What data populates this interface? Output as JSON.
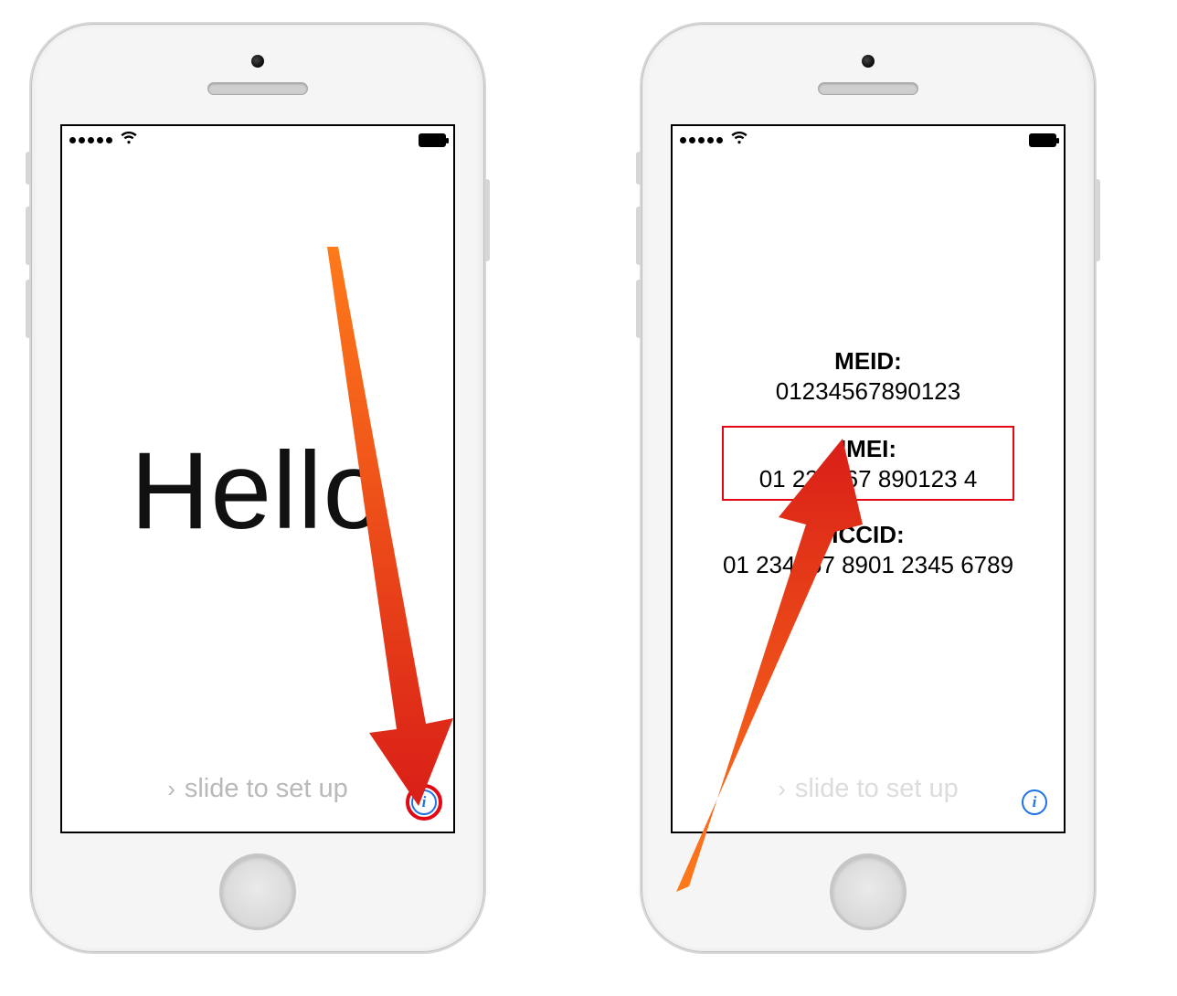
{
  "left_screen": {
    "greeting": "Hello",
    "slide_text": "slide to set up",
    "info_glyph": "i"
  },
  "right_screen": {
    "meid_label": "MEID:",
    "meid_value": "01234567890123",
    "imei_label": "IMEI:",
    "imei_value": "01 234567 890123 4",
    "iccid_label": "ICCID:",
    "iccid_value": "01 234567 8901 2345 6789",
    "slide_text": "slide to set up",
    "info_glyph": "i"
  },
  "colors": {
    "highlight": "#e30613",
    "accent_blue": "#1e73e8"
  }
}
